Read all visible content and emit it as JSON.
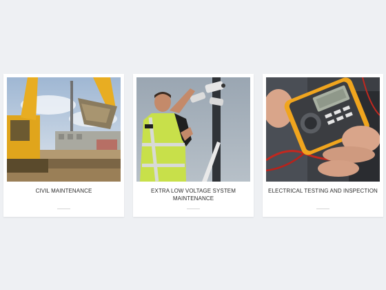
{
  "cards": [
    {
      "title": "CIVIL MAINTENANCE",
      "icon": "excavator-photo"
    },
    {
      "title": "EXTRA LOW VOLTAGE SYSTEM MAINTENANCE",
      "icon": "cctv-installation-photo"
    },
    {
      "title": "ELECTRICAL TESTING AND INSPECTION",
      "icon": "multimeter-photo"
    }
  ],
  "colors": {
    "page_background": "#eef0f3",
    "card_background": "#ffffff",
    "title_text": "#2b2b2b",
    "divider": "#d3d3d3"
  }
}
